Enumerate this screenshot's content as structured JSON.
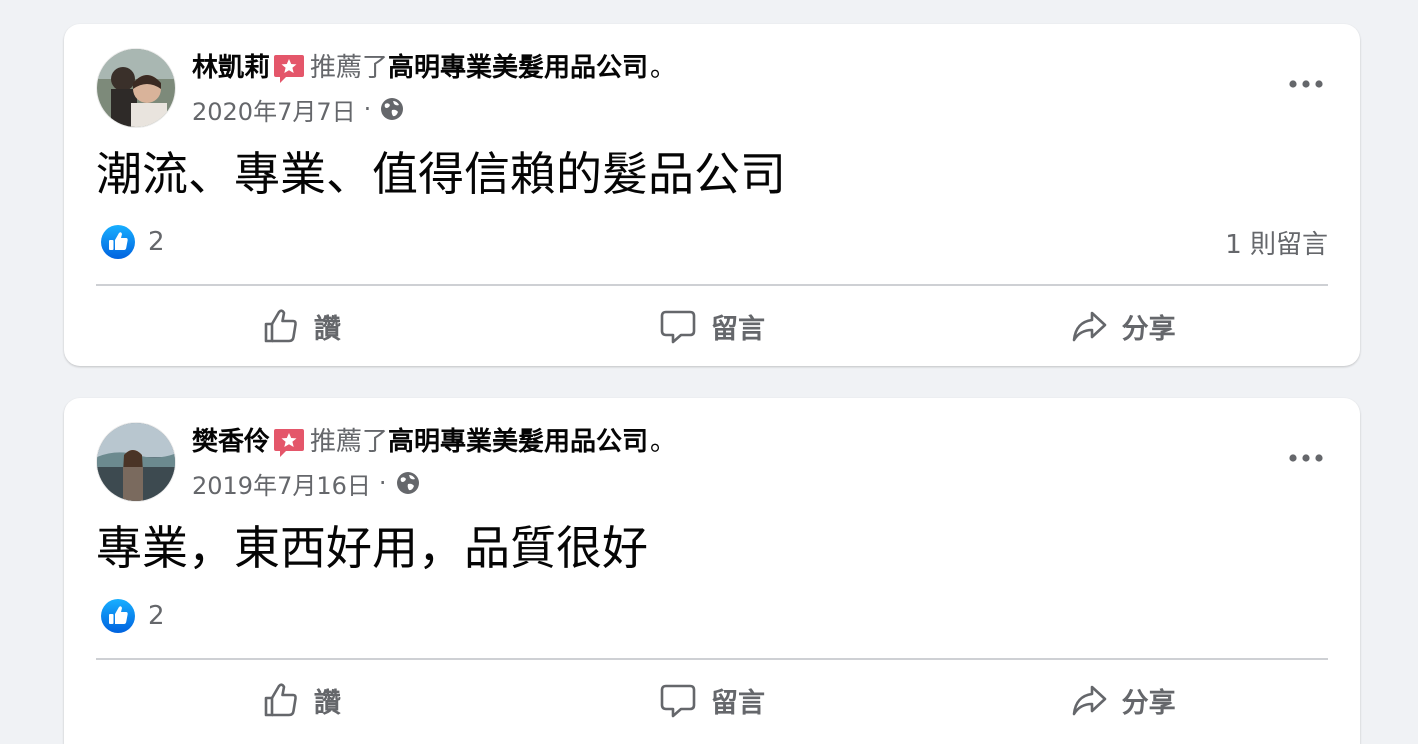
{
  "colors": {
    "background": "#f0f2f5",
    "card": "#ffffff",
    "primary_text": "#050505",
    "secondary_text": "#65676b",
    "divider": "#ced0d4",
    "like_blue": "#1877f2",
    "recommend_red": "#e4566a"
  },
  "posts": [
    {
      "author": "林凱莉",
      "recommend_icon": "recommend-star-icon",
      "recommended_text": "推薦了",
      "page_name": "高明專業美髮用品公司",
      "period": "。",
      "date": "2020年7月7日",
      "separator": "·",
      "privacy_icon": "globe-icon",
      "more_icon": "more-dots-icon",
      "text": "潮流、專業、值得信賴的髮品公司",
      "reaction_icon": "like-reaction-icon",
      "like_count": "2",
      "comment_count_text": "1 則留言",
      "actions": {
        "like": "讚",
        "comment": "留言",
        "share": "分享"
      }
    },
    {
      "author": "樊香伶",
      "recommend_icon": "recommend-star-icon",
      "recommended_text": "推薦了",
      "page_name": "高明專業美髮用品公司",
      "period": "。",
      "date": "2019年7月16日",
      "separator": "·",
      "privacy_icon": "globe-icon",
      "more_icon": "more-dots-icon",
      "text": "專業，東西好用，品質很好",
      "reaction_icon": "like-reaction-icon",
      "like_count": "2",
      "comment_count_text": "",
      "actions": {
        "like": "讚",
        "comment": "留言",
        "share": "分享"
      }
    }
  ]
}
